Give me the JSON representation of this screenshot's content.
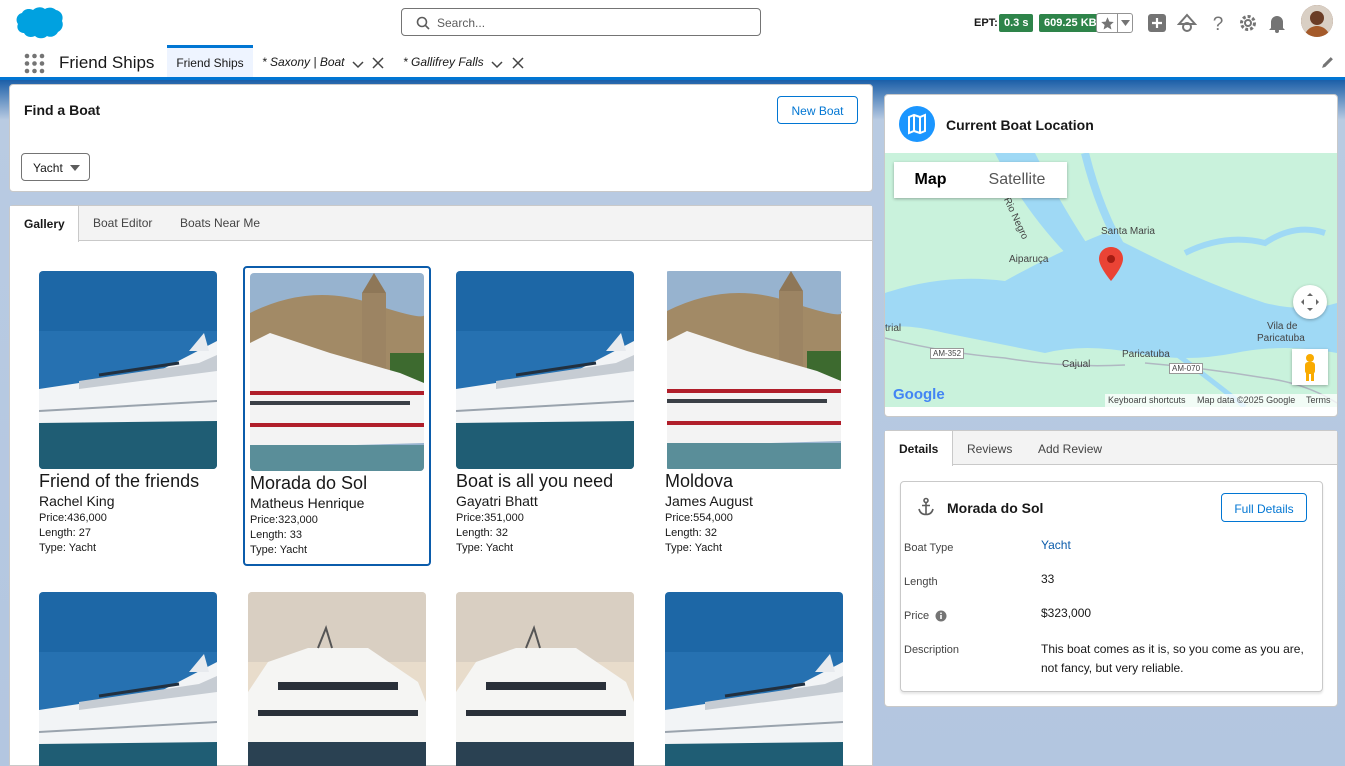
{
  "header": {
    "search_placeholder": "Search...",
    "ept_label": "EPT:",
    "ept_value": "0.3 s",
    "size_value": "609.25 KB"
  },
  "nav": {
    "app_name": "Friend Ships",
    "tabs": [
      {
        "label": "Friend Ships"
      },
      {
        "label": "* Saxony | Boat"
      },
      {
        "label": "* Gallifrey Falls"
      }
    ]
  },
  "find": {
    "title": "Find a Boat",
    "new_boat": "New Boat",
    "type_value": "Yacht"
  },
  "gallery_tabs": [
    "Gallery",
    "Boat Editor",
    "Boats Near Me"
  ],
  "boats": [
    {
      "name": "Friend of the friends",
      "owner": "Rachel King",
      "price": "Price:436,000",
      "length": "Length: 27",
      "type": "Type: Yacht"
    },
    {
      "name": "Morada do Sol",
      "owner": "Matheus Henrique",
      "price": "Price:323,000",
      "length": "Length: 33",
      "type": "Type: Yacht"
    },
    {
      "name": "Boat is all you need",
      "owner": "Gayatri Bhatt",
      "price": "Price:351,000",
      "length": "Length: 32",
      "type": "Type: Yacht"
    },
    {
      "name": "Moldova",
      "owner": "James August",
      "price": "Price:554,000",
      "length": "Length: 32",
      "type": "Type: Yacht"
    }
  ],
  "map": {
    "title": "Current Boat Location",
    "tab_map": "Map",
    "tab_satellite": "Satellite",
    "labels": {
      "santa_maria": "Santa Maria",
      "aiparuca": "Aiparuça",
      "rio_negro": "Rio Negro",
      "vila": "Vila de",
      "paricatuba1": "Paricatuba",
      "paricatuba2": "Paricatuba",
      "cajual": "Cajual",
      "am352": "AM-352",
      "am070": "AM-070",
      "trial": "trial"
    },
    "google": "Google",
    "footer_keys": "Keyboard shortcuts",
    "footer_data": "Map data ©2025 Google",
    "footer_terms": "Terms"
  },
  "details": {
    "tabs": [
      "Details",
      "Reviews",
      "Add Review"
    ],
    "boat_name": "Morada do Sol",
    "full_details": "Full Details",
    "fields": [
      {
        "label": "Boat Type",
        "value": "Yacht"
      },
      {
        "label": "Length",
        "value": "33"
      },
      {
        "label": "Price",
        "value": "$323,000"
      },
      {
        "label": "Description",
        "value": "This boat comes as it is, so you come as you are, not fancy, but very reliable."
      }
    ]
  }
}
